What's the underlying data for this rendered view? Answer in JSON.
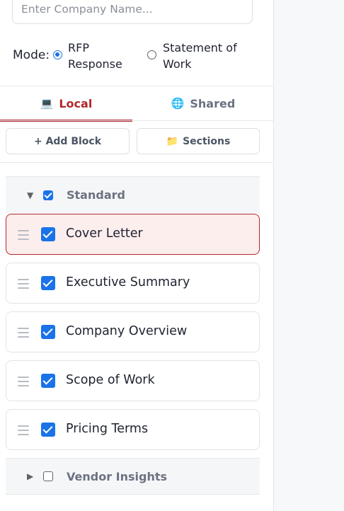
{
  "company_input": {
    "placeholder": "Enter Company Name..."
  },
  "mode": {
    "label": "Mode:",
    "options": [
      {
        "line1": "RFP",
        "line2": "Response",
        "selected": true
      },
      {
        "line1": "Statement of",
        "line2": "Work",
        "selected": false
      }
    ]
  },
  "tabs": [
    {
      "icon": "💻",
      "label": "Local",
      "active": true
    },
    {
      "icon": "🌐",
      "label": "Shared",
      "active": false
    }
  ],
  "toolbar": {
    "add_block_label": "+ Add Block",
    "sections_icon": "📁",
    "sections_label": "Sections"
  },
  "groups": {
    "standard": {
      "caret": "▼",
      "label": "Standard",
      "checked": true
    },
    "vendor": {
      "caret": "▶",
      "label": "Vendor Insights",
      "checked": false
    }
  },
  "blocks": [
    {
      "label": "Cover Letter",
      "checked": true,
      "active": true
    },
    {
      "label": "Executive Summary",
      "checked": true,
      "active": false
    },
    {
      "label": "Company Overview",
      "checked": true,
      "active": false
    },
    {
      "label": "Scope of Work",
      "checked": true,
      "active": false
    },
    {
      "label": "Pricing Terms",
      "checked": true,
      "active": false
    }
  ],
  "colors": {
    "accent_red": "#b3262b",
    "checkbox_blue": "#1a73e8",
    "active_block_bg": "#fdeeee"
  }
}
